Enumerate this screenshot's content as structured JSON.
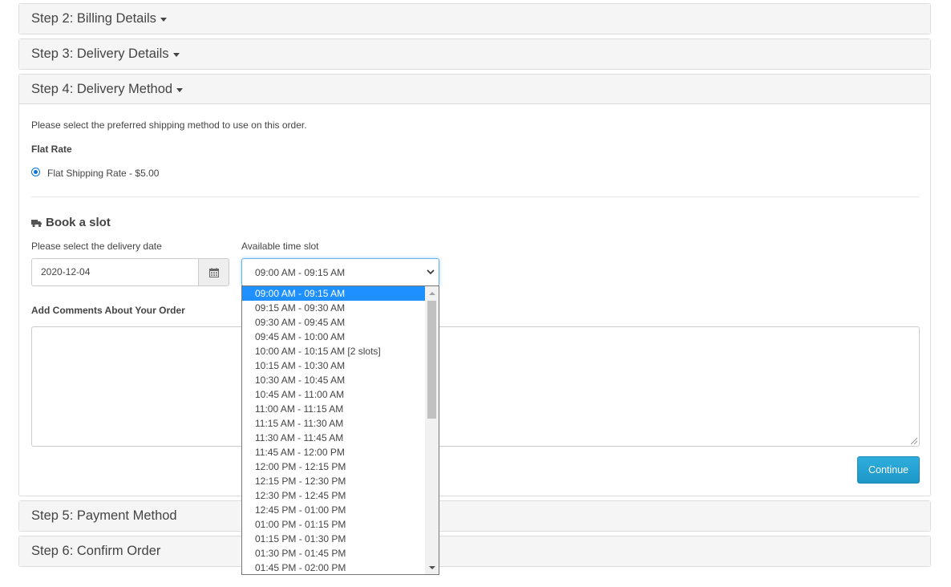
{
  "steps": {
    "step2": "Step 2: Billing Details",
    "step3": "Step 3: Delivery Details",
    "step4": "Step 4: Delivery Method",
    "step5": "Step 5: Payment Method",
    "step6": "Step 6: Confirm Order"
  },
  "delivery": {
    "intro": "Please select the preferred shipping method to use on this order.",
    "method_group": "Flat Rate",
    "method_option": "Flat Shipping Rate - $5.00",
    "method_selected": true,
    "book_slot_title": "Book a slot",
    "truck_icon": "truck-icon",
    "date_label": "Please select the delivery date",
    "date_value": "2020-12-04",
    "calendar_icon": "calendar-icon",
    "slot_label": "Available time slot",
    "slot_selected": "09:00 AM - 09:15 AM",
    "slot_options": [
      "09:00 AM - 09:15 AM",
      "09:15 AM - 09:30 AM",
      "09:30 AM - 09:45 AM",
      "09:45 AM - 10:00 AM",
      "10:00 AM - 10:15 AM [2 slots]",
      "10:15 AM - 10:30 AM",
      "10:30 AM - 10:45 AM",
      "10:45 AM - 11:00 AM",
      "11:00 AM - 11:15 AM",
      "11:15 AM - 11:30 AM",
      "11:30 AM - 11:45 AM",
      "11:45 AM - 12:00 PM",
      "12:00 PM - 12:15 PM",
      "12:15 PM - 12:30 PM",
      "12:30 PM - 12:45 PM",
      "12:45 PM - 01:00 PM",
      "01:00 PM - 01:15 PM",
      "01:15 PM - 01:30 PM",
      "01:30 PM - 01:45 PM",
      "01:45 PM - 02:00 PM"
    ],
    "comments_label": "Add Comments About Your Order",
    "comments_value": "",
    "continue_label": "Continue"
  },
  "colors": {
    "accent": "#1e90ff",
    "button": "#1d96c6",
    "panel_heading": "#f5f5f5"
  }
}
